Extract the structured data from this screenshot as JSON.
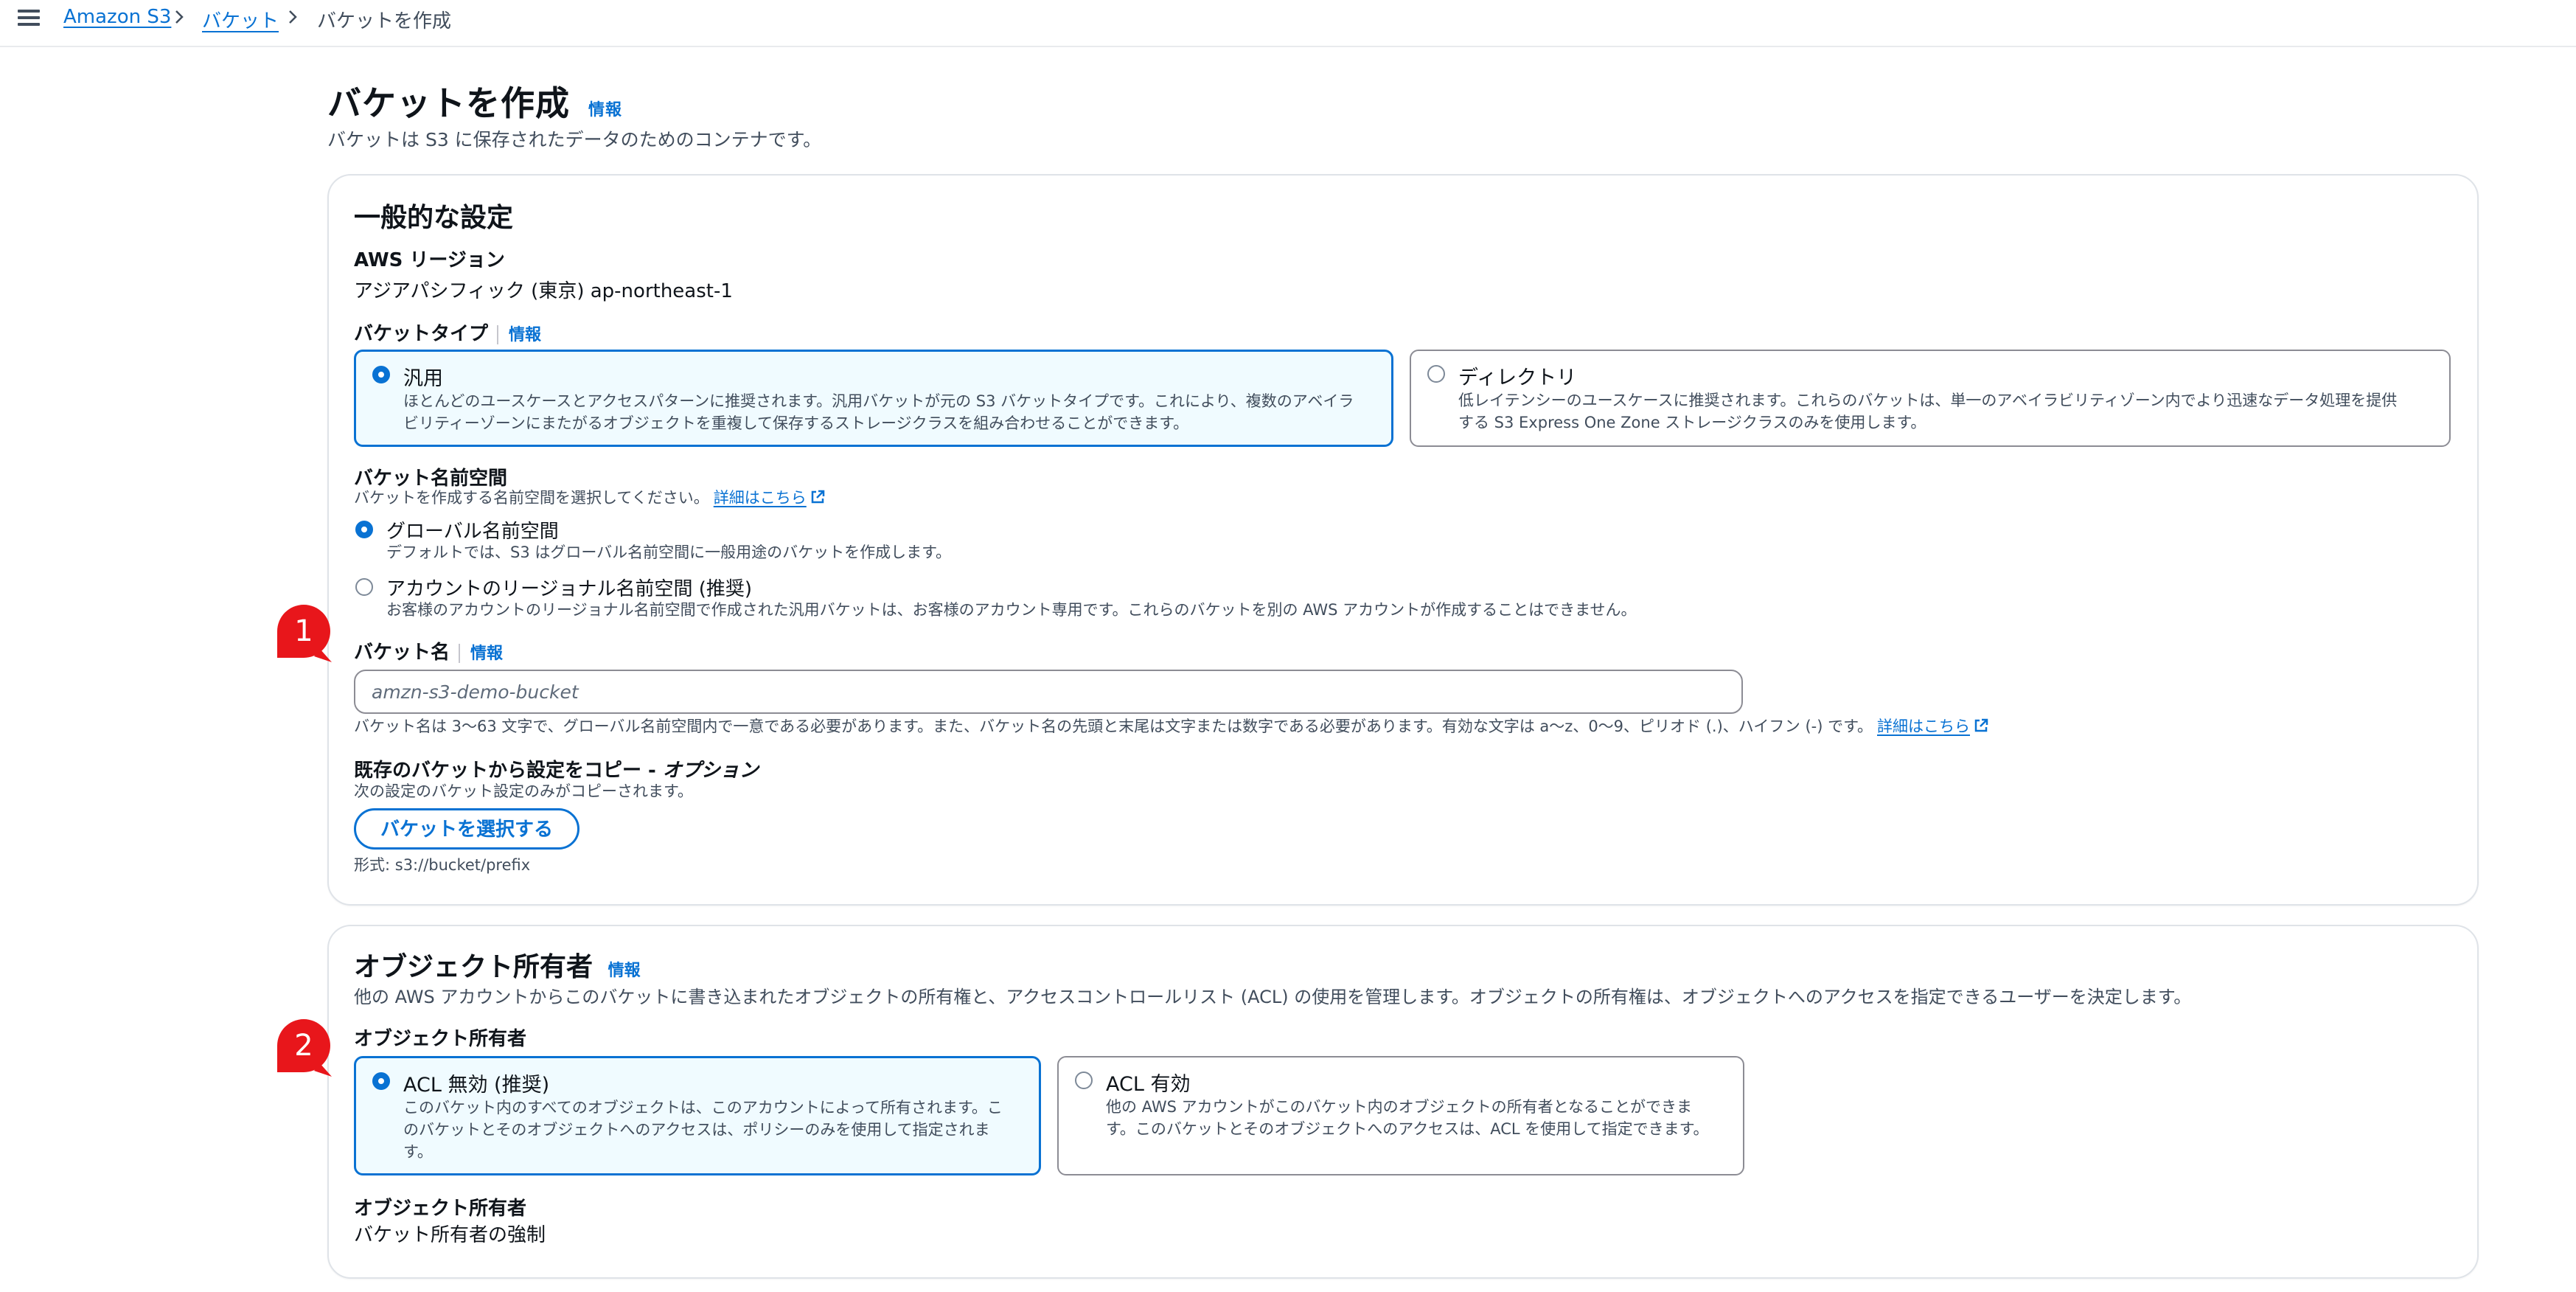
{
  "breadcrumb": {
    "home": "Amazon S3",
    "buckets": "バケット",
    "current": "バケットを作成"
  },
  "page": {
    "title": "バケットを作成",
    "info": "情報",
    "description": "バケットは S3 に保存されたデータのためのコンテナです。"
  },
  "general": {
    "heading": "一般的な設定",
    "region_label": "AWS リージョン",
    "region_value": "アジアパシフィック (東京) ap-northeast-1",
    "bucket_type_label": "バケットタイプ",
    "info": "情報",
    "type_general_title": "汎用",
    "type_general_desc_1": "ほとんどのユースケースとアクセスパターンに推奨されます。汎用バケットが元の S3 バケットタイプです。これにより、複数のアベイラ",
    "type_general_desc_2": "ビリティーゾーンにまたがるオブジェクトを重複して保存するストレージクラスを組み合わせることができます。",
    "type_directory_title": "ディレクトリ",
    "type_directory_desc_1": "低レイテンシーのユースケースに推奨されます。これらのバケットは、単一のアベイラビリティゾーン内でより迅速なデータ処理を提供",
    "type_directory_desc_2": "する S3 Express One Zone ストレージクラスのみを使用します。",
    "namespace_label": "バケット名前空間",
    "namespace_desc": "バケットを作成する名前空間を選択してください。",
    "learn_more": "詳細はこちら",
    "ns_global_title": "グローバル名前空間",
    "ns_global_desc": "デフォルトでは、S3 はグローバル名前空間に一般用途のバケットを作成します。",
    "ns_regional_title": "アカウントのリージョナル名前空間 (推奨)",
    "ns_regional_desc": "お客様のアカウントのリージョナル名前空間で作成された汎用バケットは、お客様のアカウント専用です。これらのバケットを別の AWS アカウントが作成することはできません。",
    "bucket_name_label": "バケット名",
    "bucket_name_placeholder": "amzn-s3-demo-bucket",
    "bucket_name_hint": "バケット名は 3～63 文字で、グローバル名前空間内で一意である必要があります。また、バケット名の先頭と末尾は文字または数字である必要があります。有効な文字は a～z、0～9、ピリオド (.)、ハイフン (-) です。",
    "copy_label": "既存のバケットから設定をコピー - ",
    "copy_optional": "オプション",
    "copy_desc": "次の設定のバケット設定のみがコピーされます。",
    "choose_bucket_button": "バケットを選択する",
    "format_hint": "形式: s3://bucket/prefix"
  },
  "ownership": {
    "heading": "オブジェクト所有者",
    "info": "情報",
    "description": "他の AWS アカウントからこのバケットに書き込まれたオブジェクトの所有権と、アクセスコントロールリスト (ACL) の使用を管理します。オブジェクトの所有権は、オブジェクトへのアクセスを指定できるユーザーを決定します。",
    "field_label": "オブジェクト所有者",
    "acl_disabled_title": "ACL 無効 (推奨)",
    "acl_disabled_desc_1": "このバケット内のすべてのオブジェクトは、このアカウントによって所有されます。こ",
    "acl_disabled_desc_2": "のバケットとそのオブジェクトへのアクセスは、ポリシーのみを使用して指定されま",
    "acl_disabled_desc_3": "す。",
    "acl_enabled_title": "ACL 有効",
    "acl_enabled_desc_1": "他の AWS アカウントがこのバケット内のオブジェクトの所有者となることができま",
    "acl_enabled_desc_2": "す。このバケットとそのオブジェクトへのアクセスは、ACL を使用して指定できます。",
    "owner_label": "オブジェクト所有者",
    "owner_value": "バケット所有者の強制"
  },
  "markers": {
    "one": "1",
    "two": "2"
  },
  "colors": {
    "accent": "#0972d3",
    "marker": "#e8161b",
    "selected_tile_bg": "#f0fbff"
  }
}
